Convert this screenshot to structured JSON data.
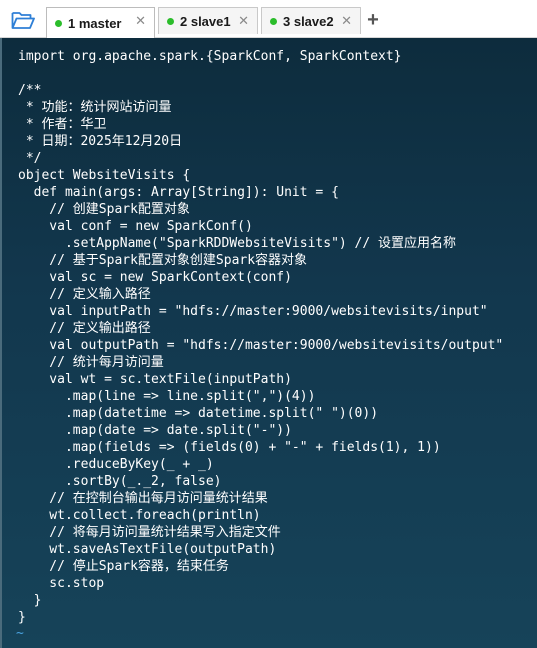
{
  "tabs": [
    {
      "label": "1 master",
      "active": true,
      "status": "connected"
    },
    {
      "label": "2 slave1",
      "active": false,
      "status": "connected"
    },
    {
      "label": "3 slave2",
      "active": false,
      "status": "connected"
    }
  ],
  "toolbar": {
    "folder_icon": "folder-open-icon",
    "add_tab_label": "+"
  },
  "colors": {
    "status_connected": "#2bbd2b",
    "terminal_bg": "#12374d",
    "text": "#ffffff",
    "prompt_tilde": "#4aa3e0"
  },
  "code_lines": [
    "import org.apache.spark.{SparkConf, SparkContext}",
    "",
    "/**",
    " * 功能：统计网站访问量",
    " * 作者：华卫",
    " * 日期：2025年12月20日",
    " */",
    "object WebsiteVisits {",
    "  def main(args: Array[String]): Unit = {",
    "    // 创建Spark配置对象",
    "    val conf = new SparkConf()",
    "      .setAppName(\"SparkRDDWebsiteVisits\") // 设置应用名称",
    "    // 基于Spark配置对象创建Spark容器对象",
    "    val sc = new SparkContext(conf)",
    "    // 定义输入路径",
    "    val inputPath = \"hdfs://master:9000/websitevisits/input\"",
    "    // 定义输出路径",
    "    val outputPath = \"hdfs://master:9000/websitevisits/output\"",
    "    // 统计每月访问量",
    "    val wt = sc.textFile(inputPath)",
    "      .map(line => line.split(\",\")(4))",
    "      .map(datetime => datetime.split(\" \")(0))",
    "      .map(date => date.split(\"-\"))",
    "      .map(fields => (fields(0) + \"-\" + fields(1), 1))",
    "      .reduceByKey(_ + _)",
    "      .sortBy(_._2, false)",
    "    // 在控制台输出每月访问量统计结果",
    "    wt.collect.foreach(println)",
    "    // 将每月访问量统计结果写入指定文件",
    "    wt.saveAsTextFile(outputPath)",
    "    // 停止Spark容器，结束任务",
    "    sc.stop",
    "  }",
    "}"
  ],
  "prompt_tilde": "~"
}
